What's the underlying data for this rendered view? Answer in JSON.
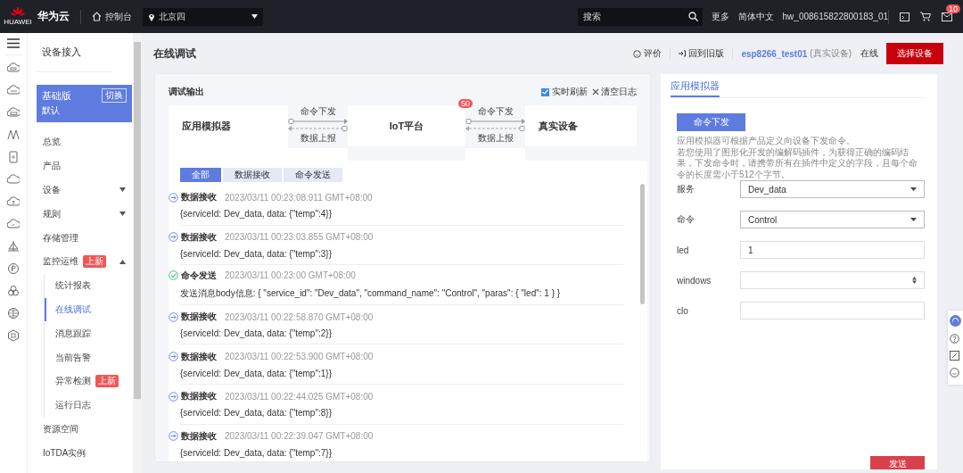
{
  "top_bar": {
    "logo_text": "HUAWEI",
    "brand": "华为云",
    "console": "控制台",
    "region": "北京四",
    "search": {
      "placeholder": "搜索"
    },
    "links": [
      "更多",
      "简体中文",
      "hw_008615822800183_01"
    ],
    "notification_count": "10"
  },
  "sidebar": {
    "title": "设备接入",
    "edition": {
      "name": "基础版",
      "switch": "切换",
      "note": "默认"
    },
    "items": [
      {
        "label": "总览",
        "selected": false
      },
      {
        "label": "产品",
        "selected": false
      },
      {
        "label": "设备",
        "selected": false,
        "expanded": false
      },
      {
        "label": "规则",
        "selected": false,
        "expanded": false
      },
      {
        "label": "存储管理",
        "selected": false
      },
      {
        "label": "监控运维",
        "selected": false,
        "expanded": true,
        "badge": "上新",
        "children": [
          {
            "label": "统计报表",
            "selected": false
          },
          {
            "label": "在线调试",
            "selected": true
          },
          {
            "label": "消息跟踪",
            "selected": false
          },
          {
            "label": "当前告警",
            "selected": false
          },
          {
            "label": "异常检测",
            "selected": false,
            "badge": "上新"
          },
          {
            "label": "运行日志",
            "selected": false
          }
        ]
      },
      {
        "label": "资源空间",
        "selected": false
      },
      {
        "label": "IoTDA实例",
        "selected": false
      }
    ]
  },
  "page": {
    "title": "在线调试",
    "rate": "评价",
    "old_version": "回到旧版",
    "device": "esp8266_test01",
    "device_type": "(真实设备)",
    "status": "在线",
    "select_button": "选择设备"
  },
  "debug": {
    "title": "调试输出",
    "realtime": {
      "label": "实时刷新",
      "checked": true
    },
    "clear": "清空日志",
    "flow": {
      "nodes": [
        "应用模拟器",
        "IoT平台",
        "真实设备"
      ],
      "links": [
        {
          "down_label": "命令下发",
          "up_label": "数据上报"
        },
        {
          "down_label": "命令下发",
          "up_label": "数据上报"
        }
      ],
      "badge": "50"
    },
    "tabs": [
      {
        "label": "全部",
        "selected": true
      },
      {
        "label": "数据接收",
        "selected": false
      },
      {
        "label": "命令发送",
        "selected": false
      }
    ],
    "logs": [
      {
        "kind": "receive",
        "title": "数据接收",
        "time": "2023/03/11 00:23:08.911 GMT+08:00",
        "body": "{serviceId: Dev_data, data: {\"temp\":4}}"
      },
      {
        "kind": "receive",
        "title": "数据接收",
        "time": "2023/03/11 00:23:03.855 GMT+08:00",
        "body": "{serviceId: Dev_data, data: {\"temp\":3}}"
      },
      {
        "kind": "send",
        "title": "命令发送",
        "time": "2023/03/11 00:23:00 GMT+08:00",
        "body": "发送消息body信息: { \"service_id\": \"Dev_data\", \"command_name\": \"Control\", \"paras\": { \"led\": 1 } }"
      },
      {
        "kind": "receive",
        "title": "数据接收",
        "time": "2023/03/11 00:22:58.870 GMT+08:00",
        "body": "{serviceId: Dev_data, data: {\"temp\":2}}"
      },
      {
        "kind": "receive",
        "title": "数据接收",
        "time": "2023/03/11 00:22:53.900 GMT+08:00",
        "body": "{serviceId: Dev_data, data: {\"temp\":1}}"
      },
      {
        "kind": "receive",
        "title": "数据接收",
        "time": "2023/03/11 00:22:44.025 GMT+08:00",
        "body": "{serviceId: Dev_data, data: {\"temp\":8}}"
      },
      {
        "kind": "receive",
        "title": "数据接收",
        "time": "2023/03/11 00:22:39.047 GMT+08:00",
        "body": "{serviceId: Dev_data, data: {\"temp\":7}}"
      }
    ]
  },
  "simulator": {
    "tab": {
      "label": "应用模拟器",
      "selected": true
    },
    "command_button": "命令下发",
    "description": [
      "应用模拟器可根据产品定义向设备下发命令。",
      "若您使用了图形化开发的编解码插件，为获得正确的编码结果，下发命令时，请携带所有在插件中定义的字段，且每个命令的长度需小于512个字节。"
    ],
    "fields": [
      {
        "label": "服务",
        "kind": "select",
        "value": "Dev_data"
      },
      {
        "label": "命令",
        "kind": "select",
        "value": "Control"
      },
      {
        "label": "led",
        "kind": "text",
        "value": "1"
      },
      {
        "label": "windows",
        "kind": "number"
      },
      {
        "label": "clo",
        "kind": "text"
      }
    ],
    "send_button": "发送"
  }
}
